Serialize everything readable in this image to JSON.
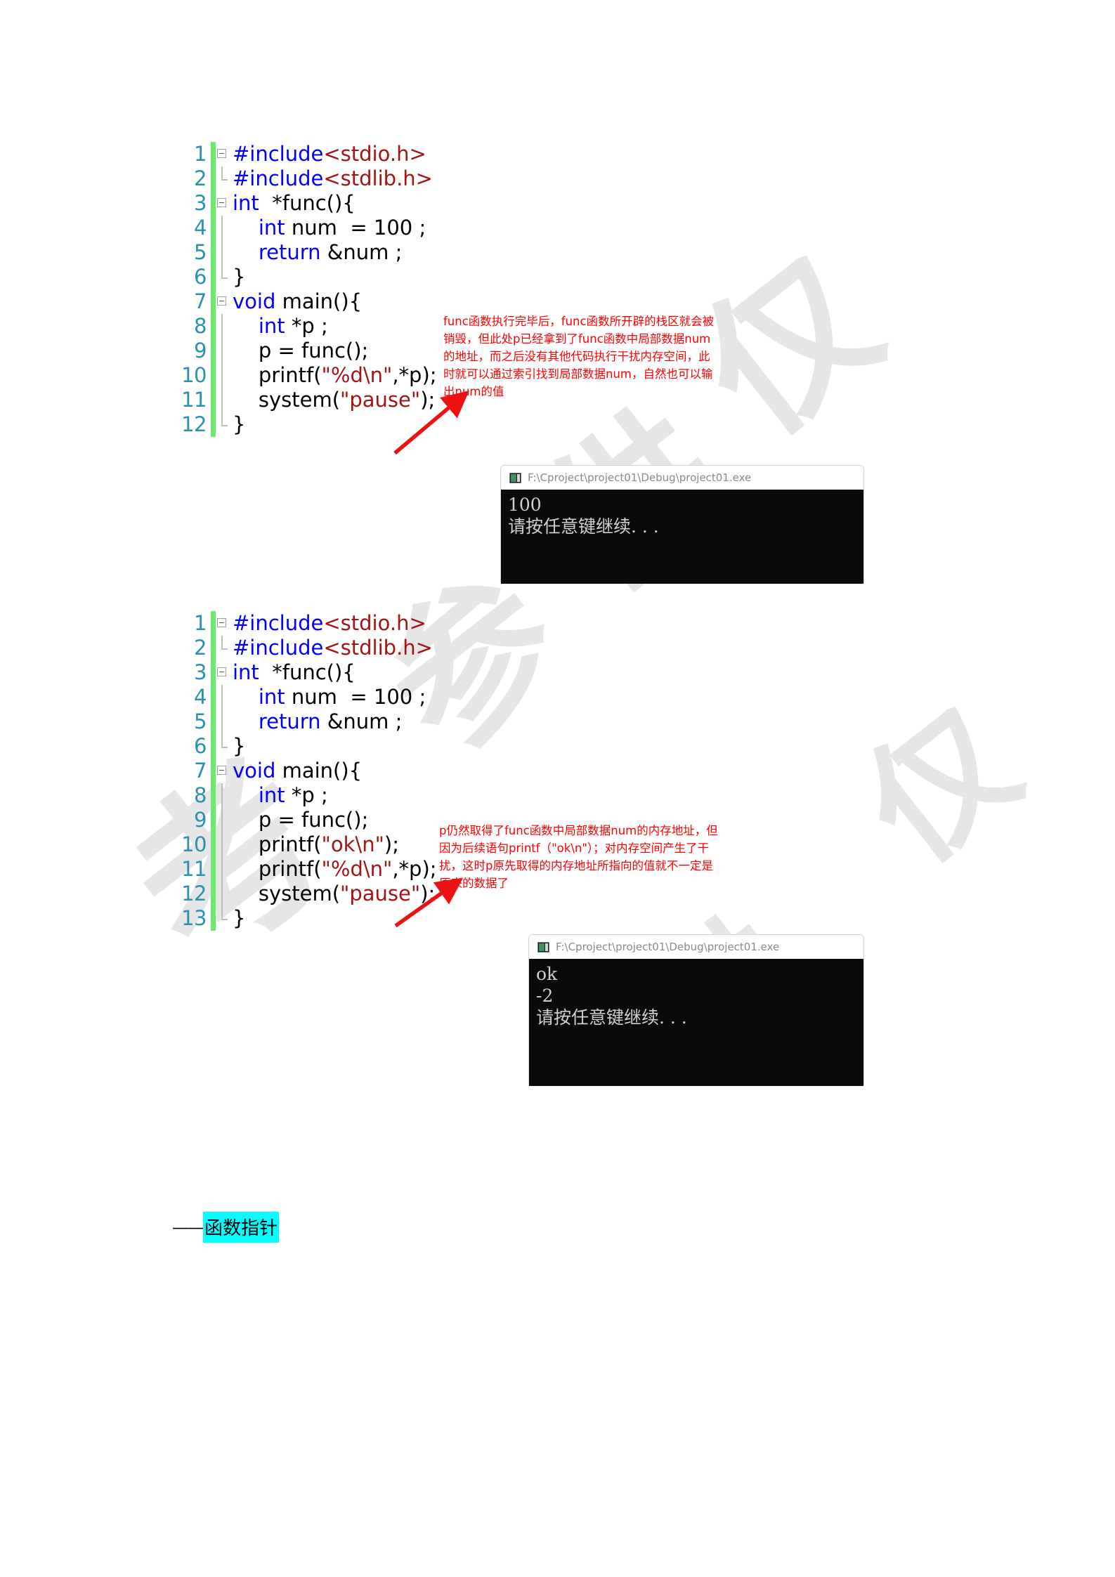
{
  "document": {
    "background_color": "#ffffff",
    "watermark": {
      "text": "仅供参考",
      "color": "#e6e6e6",
      "glyphs": [
        "仅",
        "供",
        "参",
        "考"
      ]
    }
  },
  "code_blocks": [
    {
      "id": "block-1",
      "change_bar_color": "#6ee86e",
      "line_number_color": "#2b91af",
      "lines": [
        {
          "num": "1",
          "glyph": "collapse",
          "tokens": [
            {
              "t": "#include",
              "c": "pre"
            },
            {
              "t": "<stdio.h>",
              "c": "str"
            }
          ]
        },
        {
          "num": "2",
          "glyph": "guide-end",
          "tokens": [
            {
              "t": "#include",
              "c": "pre"
            },
            {
              "t": "<stdlib.h>",
              "c": "str"
            }
          ]
        },
        {
          "num": "3",
          "glyph": "collapse",
          "tokens": [
            {
              "t": "int",
              "c": "kw"
            },
            {
              "t": "  *func(){",
              "c": "plain"
            }
          ]
        },
        {
          "num": "4",
          "glyph": "guide",
          "tokens": [
            {
              "t": "    ",
              "c": "plain"
            },
            {
              "t": "int",
              "c": "kw"
            },
            {
              "t": " num  = 100 ;",
              "c": "plain"
            }
          ]
        },
        {
          "num": "5",
          "glyph": "guide",
          "tokens": [
            {
              "t": "    ",
              "c": "plain"
            },
            {
              "t": "return",
              "c": "kw"
            },
            {
              "t": " &num ;",
              "c": "plain"
            }
          ]
        },
        {
          "num": "6",
          "glyph": "guide-end",
          "tokens": [
            {
              "t": "}",
              "c": "plain"
            }
          ]
        },
        {
          "num": "7",
          "glyph": "collapse",
          "tokens": [
            {
              "t": "void",
              "c": "kw"
            },
            {
              "t": " main(){",
              "c": "plain"
            }
          ]
        },
        {
          "num": "8",
          "glyph": "guide",
          "tokens": [
            {
              "t": "    ",
              "c": "plain"
            },
            {
              "t": "int",
              "c": "kw"
            },
            {
              "t": " *p ;",
              "c": "plain"
            }
          ]
        },
        {
          "num": "9",
          "glyph": "guide",
          "tokens": [
            {
              "t": "    p = func();",
              "c": "plain"
            }
          ]
        },
        {
          "num": "10",
          "glyph": "guide",
          "tokens": [
            {
              "t": "    printf(",
              "c": "plain"
            },
            {
              "t": "\"%d\\n\"",
              "c": "str"
            },
            {
              "t": ",*p);",
              "c": "plain"
            }
          ]
        },
        {
          "num": "11",
          "glyph": "guide",
          "tokens": [
            {
              "t": "    system(",
              "c": "plain"
            },
            {
              "t": "\"pause\"",
              "c": "str"
            },
            {
              "t": ");",
              "c": "plain"
            }
          ]
        },
        {
          "num": "12",
          "glyph": "guide-end",
          "tokens": [
            {
              "t": "}",
              "c": "plain"
            }
          ]
        }
      ]
    },
    {
      "id": "block-2",
      "change_bar_color": "#6ee86e",
      "line_number_color": "#2b91af",
      "lines": [
        {
          "num": "1",
          "glyph": "collapse",
          "tokens": [
            {
              "t": "#include",
              "c": "pre"
            },
            {
              "t": "<stdio.h>",
              "c": "str"
            }
          ]
        },
        {
          "num": "2",
          "glyph": "guide-end",
          "tokens": [
            {
              "t": "#include",
              "c": "pre"
            },
            {
              "t": "<stdlib.h>",
              "c": "str"
            }
          ]
        },
        {
          "num": "3",
          "glyph": "collapse",
          "tokens": [
            {
              "t": "int",
              "c": "kw"
            },
            {
              "t": "  *func(){",
              "c": "plain"
            }
          ]
        },
        {
          "num": "4",
          "glyph": "guide",
          "tokens": [
            {
              "t": "    ",
              "c": "plain"
            },
            {
              "t": "int",
              "c": "kw"
            },
            {
              "t": " num  = 100 ;",
              "c": "plain"
            }
          ]
        },
        {
          "num": "5",
          "glyph": "guide",
          "tokens": [
            {
              "t": "    ",
              "c": "plain"
            },
            {
              "t": "return",
              "c": "kw"
            },
            {
              "t": " &num ;",
              "c": "plain"
            }
          ]
        },
        {
          "num": "6",
          "glyph": "guide-end",
          "tokens": [
            {
              "t": "}",
              "c": "plain"
            }
          ]
        },
        {
          "num": "7",
          "glyph": "collapse",
          "tokens": [
            {
              "t": "void",
              "c": "kw"
            },
            {
              "t": " main(){",
              "c": "plain"
            }
          ]
        },
        {
          "num": "8",
          "glyph": "guide",
          "tokens": [
            {
              "t": "    ",
              "c": "plain"
            },
            {
              "t": "int",
              "c": "kw"
            },
            {
              "t": " *p ;",
              "c": "plain"
            }
          ]
        },
        {
          "num": "9",
          "glyph": "guide",
          "tokens": [
            {
              "t": "    p = func();",
              "c": "plain"
            }
          ]
        },
        {
          "num": "10",
          "glyph": "guide",
          "tokens": [
            {
              "t": "    printf(",
              "c": "plain"
            },
            {
              "t": "\"ok\\n\"",
              "c": "str"
            },
            {
              "t": ");",
              "c": "plain"
            }
          ]
        },
        {
          "num": "11",
          "glyph": "guide",
          "tokens": [
            {
              "t": "    printf(",
              "c": "plain"
            },
            {
              "t": "\"%d\\n\"",
              "c": "str"
            },
            {
              "t": ",*p);",
              "c": "plain"
            }
          ]
        },
        {
          "num": "12",
          "glyph": "guide",
          "tokens": [
            {
              "t": "    system(",
              "c": "plain"
            },
            {
              "t": "\"pause\"",
              "c": "str"
            },
            {
              "t": ");",
              "c": "plain"
            }
          ]
        },
        {
          "num": "13",
          "glyph": "guide-end",
          "tokens": [
            {
              "t": "}",
              "c": "plain"
            }
          ]
        }
      ]
    }
  ],
  "annotations": [
    {
      "id": "annotation-1",
      "color": "#ff0000",
      "lines": [
        "func函数执行完毕后，func函数所开辟的栈区就会被",
        "销毁，但此处p已经拿到了func函数中局部数据num",
        "的地址，而之后没有其他代码执行干扰内存空间，此",
        "时就可以通过索引找到局部数据num，自然也可以输",
        "出num的值"
      ]
    },
    {
      "id": "annotation-2",
      "color": "#ff0000",
      "lines": [
        "p仍然取得了func函数中局部数据num的内存地址，但",
        "因为后续语句printf（\"ok\\n\"）；对内存空间产生了干",
        "扰，这时p原先取得的内存地址所指向的值就不一定是",
        "原来的数据了"
      ]
    }
  ],
  "consoles": [
    {
      "id": "console-1",
      "title": "F:\\Cproject\\project01\\Debug\\project01.exe",
      "icon": "console-app-icon",
      "output": [
        "100",
        "请按任意键继续. . ."
      ]
    },
    {
      "id": "console-2",
      "title": "F:\\Cproject\\project01\\Debug\\project01.exe",
      "icon": "console-app-icon",
      "output": [
        "ok",
        "-2",
        "请按任意键继续. . ."
      ]
    }
  ],
  "footer": {
    "dash": "——",
    "highlighted_text": "函数指针",
    "highlight_color": "#00ffff"
  }
}
